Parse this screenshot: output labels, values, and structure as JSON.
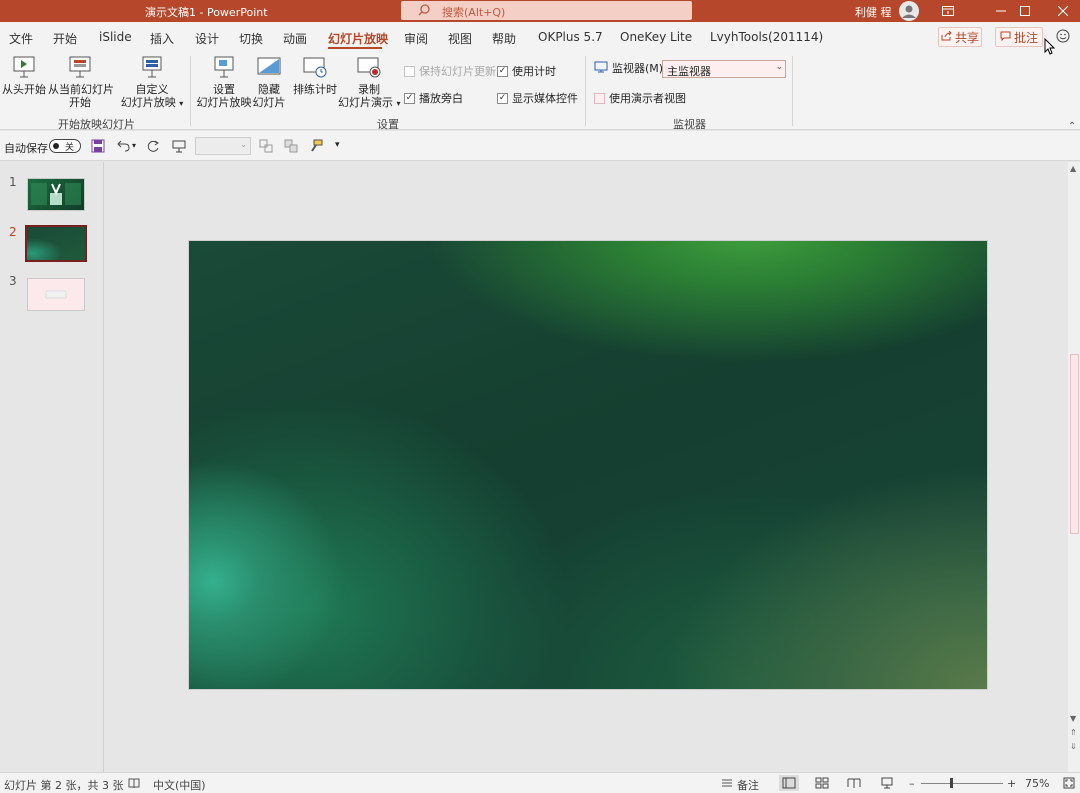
{
  "window": {
    "title": "演示文稿1  -  PowerPoint",
    "search_placeholder": "搜索(Alt+Q)",
    "user_name": "利健 程"
  },
  "tabs": [
    {
      "label": "文件"
    },
    {
      "label": "开始"
    },
    {
      "label": "iSlide"
    },
    {
      "label": "插入"
    },
    {
      "label": "设计"
    },
    {
      "label": "切换"
    },
    {
      "label": "动画"
    },
    {
      "label": "幻灯片放映"
    },
    {
      "label": "审阅"
    },
    {
      "label": "视图"
    },
    {
      "label": "帮助"
    },
    {
      "label": "OKPlus 5.7"
    },
    {
      "label": "OneKey Lite"
    },
    {
      "label": "LvyhTools(201114)"
    }
  ],
  "active_tab": "幻灯片放映",
  "header_buttons": {
    "share": "共享",
    "comment": "批注"
  },
  "ribbon": {
    "start_group": {
      "label": "开始放映幻灯片",
      "from_beginning": "从头开始",
      "from_current_1": "从当前幻灯片",
      "from_current_2": "开始",
      "custom_1": "自定义",
      "custom_2": "幻灯片放映"
    },
    "setup_group": {
      "label": "设置",
      "setup_1": "设置",
      "setup_2": "幻灯片放映",
      "hide_1": "隐藏",
      "hide_2": "幻灯片",
      "rehearse": "排练计时",
      "record_1": "录制",
      "record_2": "幻灯片演示",
      "keep_updated": "保持幻灯片更新",
      "play_narration": "播放旁白",
      "use_timings": "使用计时",
      "show_media_controls": "显示媒体控件"
    },
    "monitor_group": {
      "label": "监视器",
      "monitor_label": "监视器(M):",
      "monitor_value": "主监视器",
      "presenter_view": "使用演示者视图"
    }
  },
  "checkboxes": {
    "keep_updated": false,
    "play_narration": true,
    "use_timings": true,
    "show_media_controls": true,
    "presenter_view": false
  },
  "qat": {
    "autosave_label": "自动保存",
    "autosave_state": "关"
  },
  "slides": [
    {
      "number": "1"
    },
    {
      "number": "2"
    },
    {
      "number": "3"
    }
  ],
  "current_slide": 2,
  "status": {
    "slide_info": "幻灯片 第 2 张，共 3 张",
    "language": "中文(中国)",
    "notes": "备注",
    "zoom": "75%"
  },
  "colors": {
    "accent": "#b7472a",
    "active_thumb_border": "#7a1f1f"
  }
}
